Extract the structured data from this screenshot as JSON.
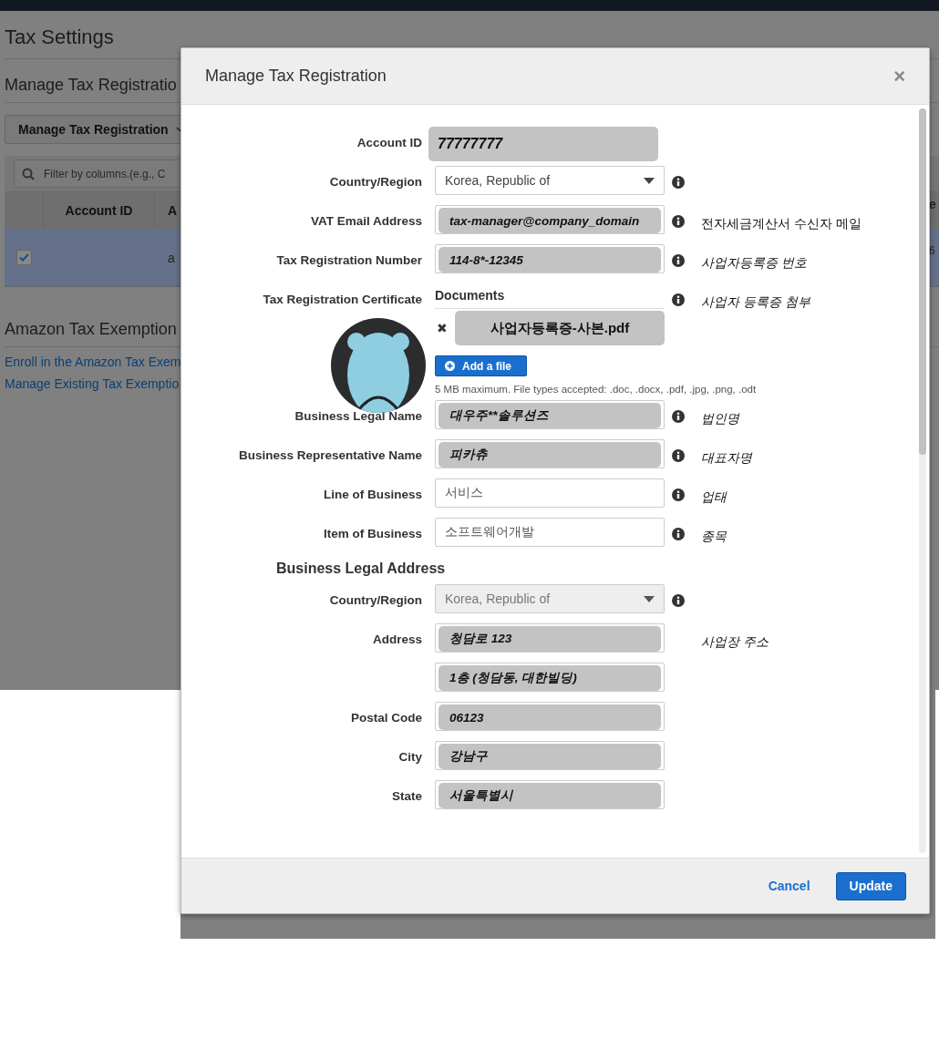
{
  "page": {
    "title": "Tax Settings",
    "section_title": "Manage Tax Registratio",
    "action_button": "Manage Tax Registration",
    "filter": {
      "placeholder": "Filter by columns.(e.g., C"
    },
    "table": {
      "columns": [
        "Account ID",
        "A",
        "e"
      ],
      "rows": [
        {
          "selected": true,
          "checked": true,
          "cells": [
            "",
            "a",
            "6"
          ]
        }
      ]
    },
    "exemption_title": "Amazon Tax Exemption",
    "links": [
      "Enroll in the Amazon Tax Exem",
      "Manage Existing Tax Exemptio"
    ]
  },
  "modal": {
    "title": "Manage Tax Registration",
    "close": "×",
    "fields": [
      {
        "kind": "redacted",
        "label": "Account ID",
        "value": "77777777",
        "info": false
      },
      {
        "kind": "select",
        "label": "Country/Region",
        "value": "Korea, Republic of",
        "disabled": false,
        "info": true
      },
      {
        "kind": "redacted_input",
        "label": "VAT Email Address",
        "value": "tax-manager@company_domain",
        "info": true,
        "note": "전자세금계산서 수신자 메일"
      },
      {
        "kind": "redacted_input",
        "label": "Tax Registration Number",
        "value": "114-8*-12345",
        "info": true,
        "note": "사업자등록증 번호"
      },
      {
        "kind": "documents",
        "label": "Tax Registration Certificate",
        "value": "Documents",
        "info": true,
        "note": "사업자 등록증 첨부",
        "file": "사업자등록증-사본.pdf",
        "remove": "✖",
        "add_button": "Add a file",
        "hint": "5 MB maximum. File types accepted: .doc, .docx, .pdf, .jpg, .png, .odt"
      },
      {
        "kind": "redacted_input",
        "label": "Business Legal Name",
        "value": "대우주**솔루션즈",
        "info": true,
        "note": "법인명"
      },
      {
        "kind": "redacted_input",
        "label": "Business Representative Name",
        "value": "피카츄",
        "info": true,
        "note": "대표자명"
      },
      {
        "kind": "input",
        "label": "Line of Business",
        "value": "서비스",
        "info": true,
        "note": "업태"
      },
      {
        "kind": "input",
        "label": "Item of Business",
        "value": "소프트웨어개발",
        "info": true,
        "note": "종목"
      },
      {
        "kind": "heading",
        "label": "Business Legal Address"
      },
      {
        "kind": "select",
        "label": "Country/Region",
        "value": "Korea, Republic of",
        "disabled": true,
        "info": true
      },
      {
        "kind": "redacted_input",
        "label": "Address",
        "value": "청담로 123",
        "info": false,
        "note": "사업장 주소"
      },
      {
        "kind": "redacted_input",
        "value": "1층 (청담동, 대한빌딩)",
        "info": false
      },
      {
        "kind": "redacted_input",
        "label": "Postal Code",
        "value": "06123",
        "info": false
      },
      {
        "kind": "redacted_input",
        "label": "City",
        "value": "강남구",
        "info": false
      },
      {
        "kind": "redacted_input",
        "label": "State",
        "value": "서울특별시",
        "info": false
      }
    ],
    "buttons": {
      "cancel": "Cancel",
      "primary": "Update"
    }
  }
}
